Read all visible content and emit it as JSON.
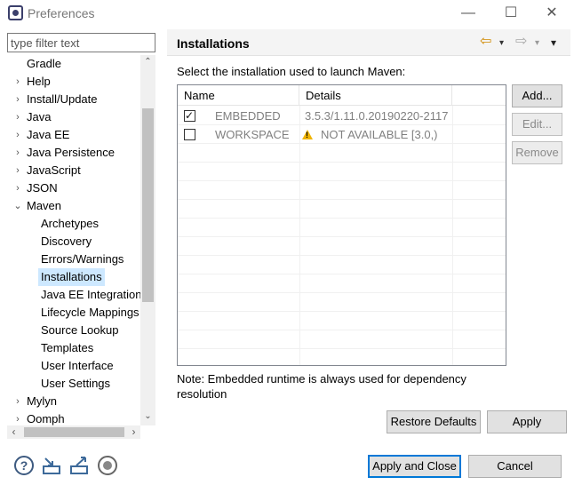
{
  "window": {
    "title": "Preferences",
    "minimize": "—",
    "maximize": "☐",
    "close": "✕"
  },
  "filter": {
    "placeholder": "type filter text",
    "value": ""
  },
  "tree": {
    "items": [
      {
        "label": "Gradle",
        "level": 0,
        "twisty": ""
      },
      {
        "label": "Help",
        "level": 0,
        "twisty": "›"
      },
      {
        "label": "Install/Update",
        "level": 0,
        "twisty": "›"
      },
      {
        "label": "Java",
        "level": 0,
        "twisty": "›"
      },
      {
        "label": "Java EE",
        "level": 0,
        "twisty": "›"
      },
      {
        "label": "Java Persistence",
        "level": 0,
        "twisty": "›"
      },
      {
        "label": "JavaScript",
        "level": 0,
        "twisty": "›"
      },
      {
        "label": "JSON",
        "level": 0,
        "twisty": "›"
      },
      {
        "label": "Maven",
        "level": 0,
        "twisty": "⌄"
      },
      {
        "label": "Archetypes",
        "level": 1,
        "twisty": ""
      },
      {
        "label": "Discovery",
        "level": 1,
        "twisty": ""
      },
      {
        "label": "Errors/Warnings",
        "level": 1,
        "twisty": ""
      },
      {
        "label": "Installations",
        "level": 1,
        "twisty": "",
        "selected": true
      },
      {
        "label": "Java EE Integration",
        "level": 1,
        "twisty": ""
      },
      {
        "label": "Lifecycle Mappings",
        "level": 1,
        "twisty": ""
      },
      {
        "label": "Source Lookup",
        "level": 1,
        "twisty": ""
      },
      {
        "label": "Templates",
        "level": 1,
        "twisty": ""
      },
      {
        "label": "User Interface",
        "level": 1,
        "twisty": ""
      },
      {
        "label": "User Settings",
        "level": 1,
        "twisty": ""
      },
      {
        "label": "Mylyn",
        "level": 0,
        "twisty": "›"
      },
      {
        "label": "Oomph",
        "level": 0,
        "twisty": "›"
      }
    ]
  },
  "page": {
    "title": "Installations",
    "instruction": "Select the installation used to launch Maven:",
    "note": "Note: Embedded runtime is always used for dependency resolution"
  },
  "nav": {
    "back": "⇦",
    "forward": "⇨",
    "menu": "▾"
  },
  "table": {
    "columns": [
      "Name",
      "Details"
    ],
    "rows": [
      {
        "checked": true,
        "name": "EMBEDDED",
        "details": "3.5.3/1.11.0.20190220-2117",
        "warning": false
      },
      {
        "checked": false,
        "name": "WORKSPACE",
        "details": "NOT AVAILABLE [3.0,)",
        "warning": true
      }
    ]
  },
  "side_buttons": {
    "add": "Add...",
    "edit": "Edit...",
    "remove": "Remove"
  },
  "page_buttons": {
    "restore_defaults": "Restore Defaults",
    "apply": "Apply"
  },
  "dialog_buttons": {
    "apply_and_close": "Apply and Close",
    "cancel": "Cancel"
  },
  "bottom_icons": [
    "help-icon",
    "import-icon",
    "export-icon",
    "record-icon"
  ],
  "colors": {
    "selection": "#cde8ff",
    "default_button_border": "#0078d7",
    "warning": "#f0b400"
  }
}
